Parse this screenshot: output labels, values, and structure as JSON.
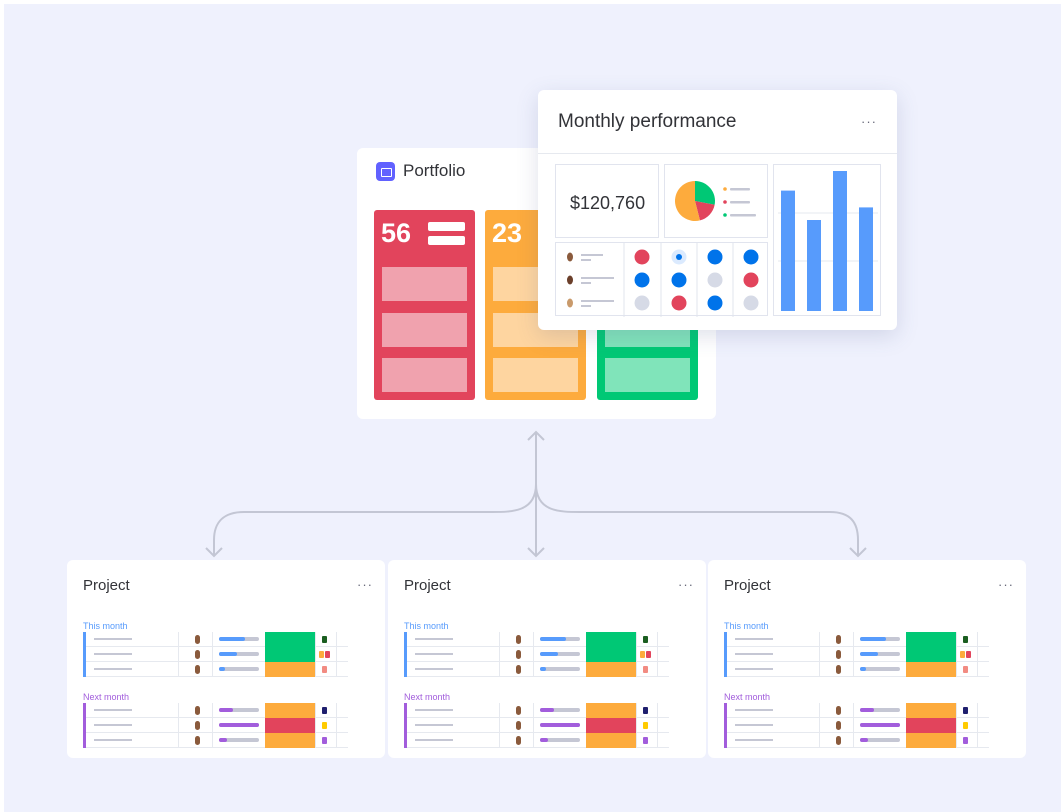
{
  "portfolio": {
    "title": "Portfolio",
    "columns": [
      {
        "number": "56",
        "color": "#e2445c",
        "light": "#f0a2ae"
      },
      {
        "number": "23",
        "color": "#fdab3d",
        "light": "#fed5a0"
      },
      {
        "number": "",
        "color": "#00c875",
        "light": "#80e4ba"
      }
    ]
  },
  "monthly": {
    "title": "Monthly performance",
    "menu": "···",
    "amount": "$120,760",
    "pie": [
      {
        "value": 0.28,
        "color": "#00c875"
      },
      {
        "value": 0.18,
        "color": "#e2445c"
      },
      {
        "value": 0.54,
        "color": "#fdab3d"
      }
    ],
    "bars": {
      "values": [
        0.86,
        0.65,
        1.0,
        0.74
      ],
      "color": "#579bfc"
    },
    "status_grid": [
      [
        "#e2445c",
        "#dbeafe",
        "#0073ea",
        "#0073ea"
      ],
      [
        "#0073ea",
        "#0073ea",
        "#d6dae6",
        "#e2445c"
      ],
      [
        "#d6dae6",
        "#e2445c",
        "#0073ea",
        "#d6dae6"
      ]
    ]
  },
  "projects": [
    {
      "title": "Project",
      "menu": "···",
      "this_month": "This month",
      "next_month": "Next month"
    },
    {
      "title": "Project",
      "menu": "···",
      "this_month": "This month",
      "next_month": "Next month"
    },
    {
      "title": "Project",
      "menu": "···",
      "this_month": "This month",
      "next_month": "Next month"
    }
  ],
  "project_rows": {
    "this_month": [
      {
        "progress": 0.65,
        "status": "#00c875",
        "docs": [
          "#1b5e20"
        ]
      },
      {
        "progress": 0.45,
        "status": "#00c875",
        "docs": [
          "#fdab3d",
          "#e2445c"
        ]
      },
      {
        "progress": 0.15,
        "status": "#fdab3d",
        "docs": [
          "#f28b82"
        ]
      }
    ],
    "next_month": [
      {
        "progress": 0.35,
        "status": "#fdab3d",
        "docs": [
          "#1f1f6e"
        ]
      },
      {
        "progress": 1.0,
        "status": "#e2445c",
        "docs": [
          "#ffcb00"
        ]
      },
      {
        "progress": 0.2,
        "status": "#fdab3d",
        "docs": [
          "#a25ddc"
        ]
      }
    ]
  },
  "colors": {
    "this_month": "#579bfc",
    "next_month": "#a25ddc",
    "connector": "#c3c6d4"
  }
}
